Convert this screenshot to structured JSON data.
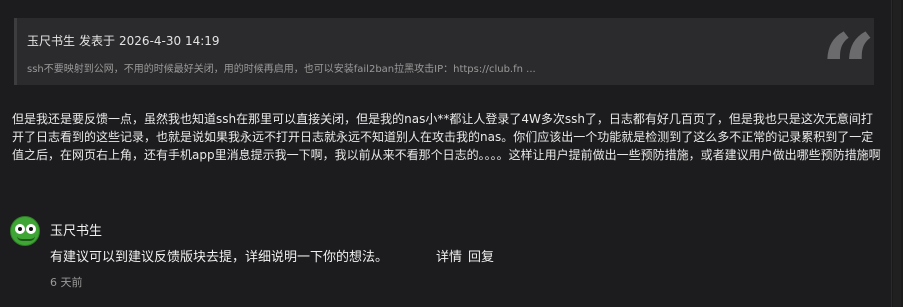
{
  "quote": {
    "author": "玉尺书生",
    "posted_label": "发表于",
    "timestamp": "2026-4-30 14:19",
    "excerpt": "ssh不要映射到公网，不用的时候最好关闭，用的时候再启用，也可以安装fail2ban拉黑攻击IP：https://club.fn ..."
  },
  "post": {
    "text": "但是我还是要反馈一点，虽然我也知道ssh在那里可以直接关闭，但是我的nas小**都让人登录了4W多次ssh了，日志都有好几百页了，但是我也只是这次无意间打开了日志看到的这些记录，也就是说如果我永远不打开日志就永远不知道别人在攻击我的nas。你们应该出一个功能就是检测到了这么多不正常的记录累积到了一定值之后，在网页右上角，还有手机app里消息提示我一下啊，我以前从来不看那个日志的。。。。这样让用户提前做出一些预防措施，或者建议用户做出哪些预防措施啊"
  },
  "reply": {
    "author": "玉尺书生",
    "text": "有建议可以到建议反馈版块去提，详细说明一下你的想法。",
    "actions": {
      "details": "详情",
      "reply": "回复"
    },
    "time": "6 天前"
  },
  "icons": {
    "quote": "quote-mark-icon",
    "avatar": "frog-avatar"
  },
  "colors": {
    "background": "#1c1c1e",
    "quote_background": "#2b2b2d",
    "text": "#eaeaea",
    "muted": "#9a9a9a"
  }
}
